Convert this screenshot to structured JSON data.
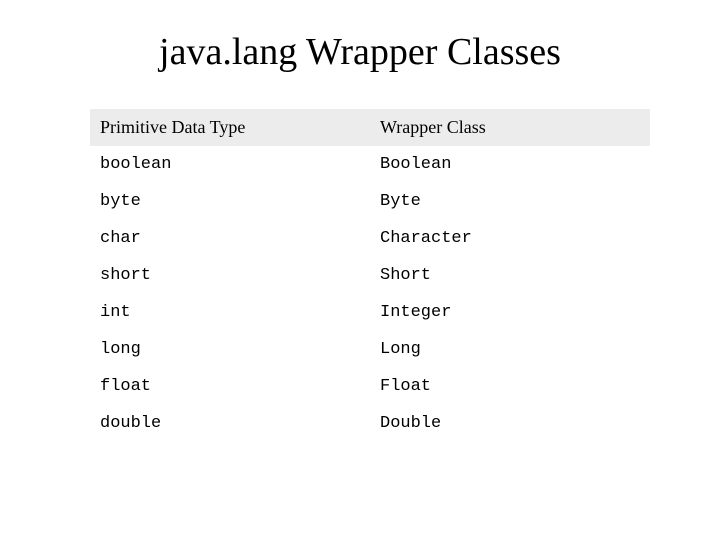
{
  "title": "java.lang Wrapper Classes",
  "table": {
    "header": {
      "col1": "Primitive Data Type",
      "col2": "Wrapper Class"
    },
    "rows": [
      {
        "primitive": "boolean",
        "wrapper": "Boolean"
      },
      {
        "primitive": "byte",
        "wrapper": "Byte"
      },
      {
        "primitive": "char",
        "wrapper": "Character"
      },
      {
        "primitive": "short",
        "wrapper": "Short"
      },
      {
        "primitive": "int",
        "wrapper": "Integer"
      },
      {
        "primitive": "long",
        "wrapper": "Long"
      },
      {
        "primitive": "float",
        "wrapper": "Float"
      },
      {
        "primitive": "double",
        "wrapper": "Double"
      }
    ]
  }
}
